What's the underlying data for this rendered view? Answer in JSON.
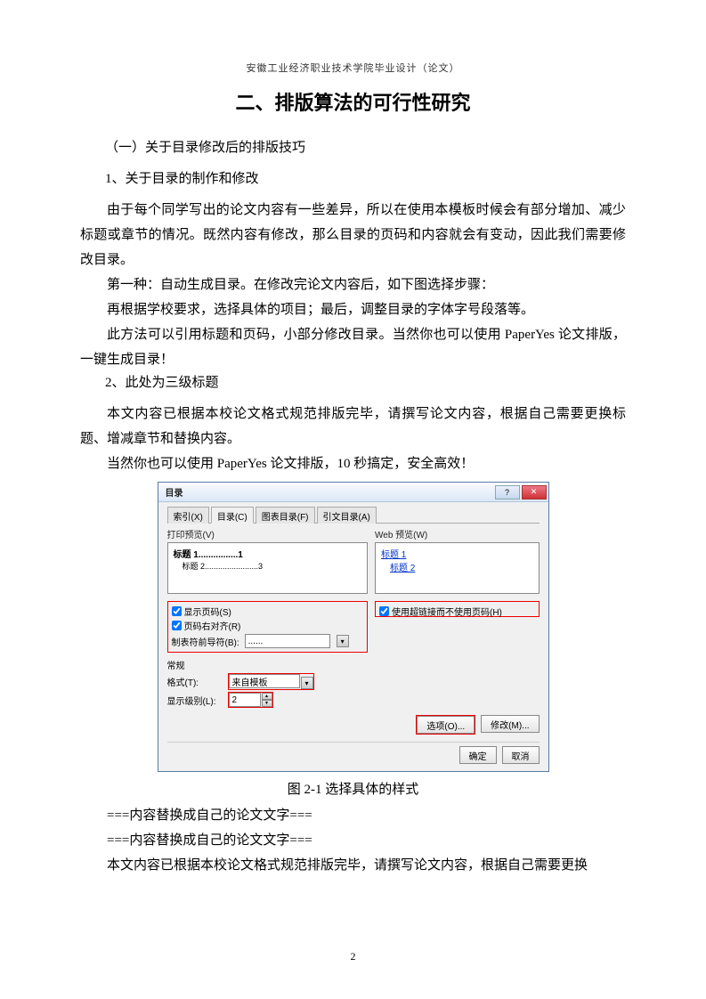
{
  "header": "安徽工业经济职业技术学院毕业设计（论文）",
  "title": "二、排版算法的可行性研究",
  "sec1": "（一）关于目录修改后的排版技巧",
  "sec2": "1、关于目录的制作和修改",
  "p1": "由于每个同学写出的论文内容有一些差异，所以在使用本模板时候会有部分增加、减少标题或章节的情况。既然内容有修改，那么目录的页码和内容就会有变动，因此我们需要修改目录。",
  "p2": "第一种：自动生成目录。在修改完论文内容后，如下图选择步骤：",
  "p3": "再根据学校要求，选择具体的项目；最后，调整目录的字体字号段落等。",
  "p4": "此方法可以引用标题和页码，小部分修改目录。当然你也可以使用 PaperYes 论文排版，一键生成目录！",
  "sec3": "2、此处为三级标题",
  "p5": "本文内容已根据本校论文格式规范排版完毕，请撰写论文内容，根据自己需要更换标题、增减章节和替换内容。",
  "p6": "当然你也可以使用 PaperYes 论文排版，10 秒搞定，安全高效！",
  "dialog": {
    "title": "目录",
    "tabs": [
      "索引(X)",
      "目录(C)",
      "图表目录(F)",
      "引文目录(A)"
    ],
    "preview_left_label": "打印预览(V)",
    "preview_right_label": "Web 预览(W)",
    "preview_l1": "标题 1................1",
    "preview_l2": "标题 2........................3",
    "preview_r1": "标题 1",
    "preview_r2": "标题 2",
    "chk1": "显示页码(S)",
    "chk2": "页码右对齐(R)",
    "chk3": "使用超链接而不使用页码(H)",
    "leader_label": "制表符前导符(B):",
    "leader_val": "......",
    "section_normal": "常规",
    "format_label": "格式(T):",
    "format_val": "来自模板",
    "levels_label": "显示级别(L):",
    "levels_val": "2",
    "btn_options": "选项(O)...",
    "btn_modify": "修改(M)...",
    "btn_ok": "确定",
    "btn_cancel": "取消"
  },
  "caption": "图 2-1  选择具体的样式",
  "ph1": "===内容替换成自己的论文文字===",
  "ph2": "===内容替换成自己的论文文字===",
  "p7": "本文内容已根据本校论文格式规范排版完毕，请撰写论文内容，根据自己需要更换",
  "page_num": "2"
}
